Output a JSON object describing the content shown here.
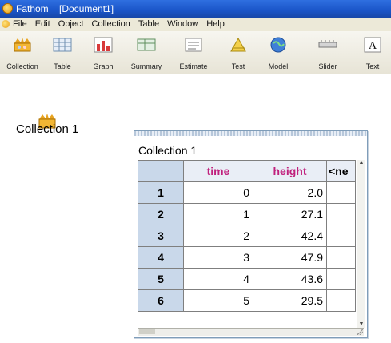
{
  "window": {
    "title": "Fathom    [Document1]"
  },
  "menu": [
    "File",
    "Edit",
    "Object",
    "Collection",
    "Table",
    "Window",
    "Help"
  ],
  "toolbar": [
    {
      "label": "Collection",
      "icon": "collection-box-icon"
    },
    {
      "label": "Table",
      "icon": "table-icon"
    },
    {
      "label": "Graph",
      "icon": "graph-icon"
    },
    {
      "label": "Summary",
      "icon": "summary-icon"
    },
    {
      "label": "Estimate",
      "icon": "estimate-icon"
    },
    {
      "label": "Test",
      "icon": "test-icon"
    },
    {
      "label": "Model",
      "icon": "model-icon"
    },
    {
      "label": "Slider",
      "icon": "slider-icon"
    },
    {
      "label": "Text",
      "icon": "text-icon"
    }
  ],
  "collection": {
    "name": "Collection 1"
  },
  "case_table": {
    "title": "Collection 1",
    "columns": [
      "time",
      "height",
      "<ne"
    ],
    "rows": [
      {
        "index": "1",
        "time": "0",
        "height": "2.0"
      },
      {
        "index": "2",
        "time": "1",
        "height": "27.1"
      },
      {
        "index": "3",
        "time": "2",
        "height": "42.4"
      },
      {
        "index": "4",
        "time": "3",
        "height": "47.9"
      },
      {
        "index": "5",
        "time": "4",
        "height": "43.6"
      },
      {
        "index": "6",
        "time": "5",
        "height": "29.5"
      }
    ]
  },
  "colors": {
    "attribute_header": "#c0207c",
    "index_cell": "#c9d8ea",
    "titlebar": "#1a55c8"
  }
}
